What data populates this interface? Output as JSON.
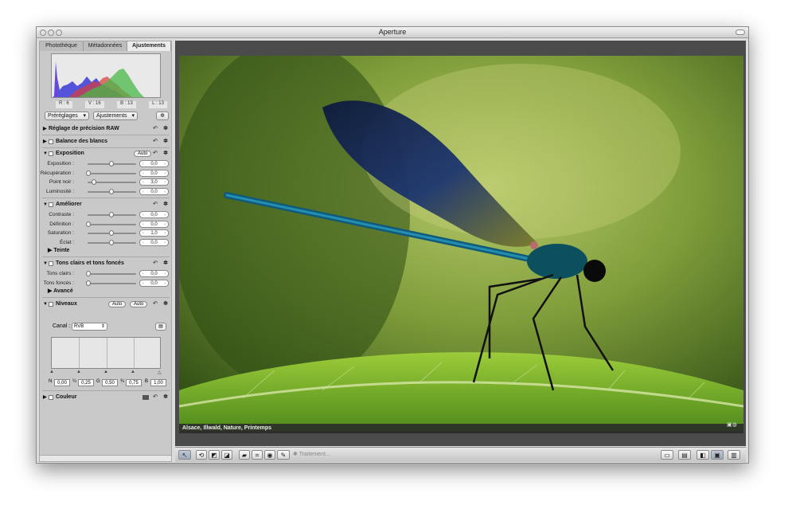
{
  "window": {
    "title": "Aperture"
  },
  "inspector": {
    "tabs": [
      "Photothèque",
      "Métadonnées",
      "Ajustements"
    ],
    "active_tab": "Ajustements",
    "histogram_readout": {
      "r": "R : 6",
      "v": "V : 16",
      "b": "B : 13",
      "l": "L : 13"
    },
    "presets_dropdown": "Préréglages",
    "adjustments_dropdown": "Ajustements",
    "sections": {
      "raw": "Réglage de précision RAW",
      "wb": "Balance des blancs",
      "exposure": "Exposition",
      "enhance": "Améliorer",
      "shadows": "Tons clairs et tons foncés",
      "levels": "Niveaux",
      "color": "Couleur"
    },
    "auto_label": "Auto",
    "exposure_rows": [
      {
        "label": "Exposition :",
        "value": "0,0",
        "pos": 0.5
      },
      {
        "label": "Récupération :",
        "value": "0,0",
        "pos": 0.0
      },
      {
        "label": "Point noir :",
        "value": "3,0",
        "pos": 0.12
      },
      {
        "label": "Luminosité :",
        "value": "0,0",
        "pos": 0.5
      }
    ],
    "enhance_rows": [
      {
        "label": "Contraste :",
        "value": "0,0",
        "pos": 0.5
      },
      {
        "label": "Définition :",
        "value": "0,0",
        "pos": 0.0
      },
      {
        "label": "Saturation :",
        "value": "1,0",
        "pos": 0.5
      },
      {
        "label": "Éclat :",
        "value": "0,0",
        "pos": 0.5
      }
    ],
    "tint_label": "Teinte",
    "shadow_rows": [
      {
        "label": "Tons clairs :",
        "value": "0,0",
        "pos": 0.0
      },
      {
        "label": "Tons foncés :",
        "value": "0,0",
        "pos": 0.0
      }
    ],
    "advanced_label": "Avancé",
    "levels": {
      "channel_label": "Canal :",
      "channel_value": "RVB",
      "n_label": "N",
      "n_value": "0,00",
      "q1_label": "¼",
      "q1_value": "0,25",
      "g_label": "G",
      "g_value": "0,50",
      "q3_label": "¾",
      "q3_value": "0,75",
      "b_label": "B",
      "b_value": "1,00"
    }
  },
  "viewer": {
    "caption": "Alsace, Illwald, Nature, Printemps"
  },
  "toolbar": {
    "processing": "Traitement..."
  }
}
